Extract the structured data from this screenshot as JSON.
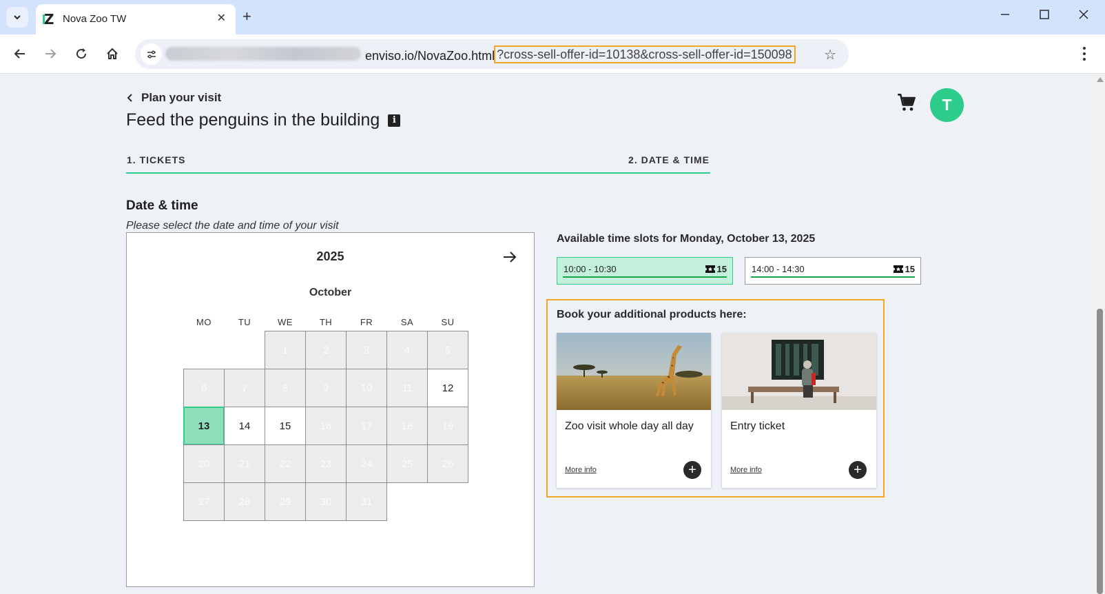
{
  "browser": {
    "tab_title": "Nova Zoo TW",
    "url_host": "enviso.io/NovaZoo.html",
    "url_query": "?cross-sell-offer-id=10138&cross-sell-offer-id=150098"
  },
  "header": {
    "back_label": "Plan your visit",
    "title": "Feed the penguins in the building",
    "avatar_initial": "T"
  },
  "steps": [
    {
      "label": "1. TICKETS"
    },
    {
      "label": "2. DATE & TIME"
    }
  ],
  "date_section": {
    "title": "Date & time",
    "subtitle": "Please select the date and time of your visit"
  },
  "calendar": {
    "year": "2025",
    "month": "October",
    "weekdays": [
      "MO",
      "TU",
      "WE",
      "TH",
      "FR",
      "SA",
      "SU"
    ],
    "days": [
      {
        "d": "1",
        "s": "disabled"
      },
      {
        "d": "2",
        "s": "disabled"
      },
      {
        "d": "3",
        "s": "disabled"
      },
      {
        "d": "4",
        "s": "disabled"
      },
      {
        "d": "5",
        "s": "disabled"
      },
      {
        "d": "6",
        "s": "disabled"
      },
      {
        "d": "7",
        "s": "disabled"
      },
      {
        "d": "8",
        "s": "disabled"
      },
      {
        "d": "9",
        "s": "disabled"
      },
      {
        "d": "10",
        "s": "disabled"
      },
      {
        "d": "11",
        "s": "disabled"
      },
      {
        "d": "12",
        "s": "available"
      },
      {
        "d": "13",
        "s": "selected"
      },
      {
        "d": "14",
        "s": "available"
      },
      {
        "d": "15",
        "s": "available"
      },
      {
        "d": "16",
        "s": "disabled"
      },
      {
        "d": "17",
        "s": "disabled"
      },
      {
        "d": "18",
        "s": "disabled"
      },
      {
        "d": "19",
        "s": "disabled"
      },
      {
        "d": "20",
        "s": "disabled"
      },
      {
        "d": "21",
        "s": "disabled"
      },
      {
        "d": "22",
        "s": "disabled"
      },
      {
        "d": "23",
        "s": "disabled"
      },
      {
        "d": "24",
        "s": "disabled"
      },
      {
        "d": "25",
        "s": "disabled"
      },
      {
        "d": "26",
        "s": "disabled"
      },
      {
        "d": "27",
        "s": "disabled"
      },
      {
        "d": "28",
        "s": "disabled"
      },
      {
        "d": "29",
        "s": "disabled"
      },
      {
        "d": "30",
        "s": "disabled"
      },
      {
        "d": "31",
        "s": "disabled"
      }
    ]
  },
  "timeslots": {
    "heading": "Available time slots for Monday, October 13, 2025",
    "slots": [
      {
        "time": "10:00 - 10:30",
        "count": "15",
        "selected": true
      },
      {
        "time": "14:00 - 14:30",
        "count": "15",
        "selected": false
      }
    ]
  },
  "cross_sell": {
    "heading": "Book your additional products here:",
    "products": [
      {
        "name": "Zoo visit whole day all day",
        "more_info": "More info",
        "image": "giraffe-savanna-photo"
      },
      {
        "name": "Entry ticket",
        "more_info": "More info",
        "image": "museum-visitor-photo"
      }
    ]
  },
  "colors": {
    "accent": "#2dcc8b",
    "highlight": "#f5a623",
    "selected_slot_bg": "#c3f0dc"
  }
}
